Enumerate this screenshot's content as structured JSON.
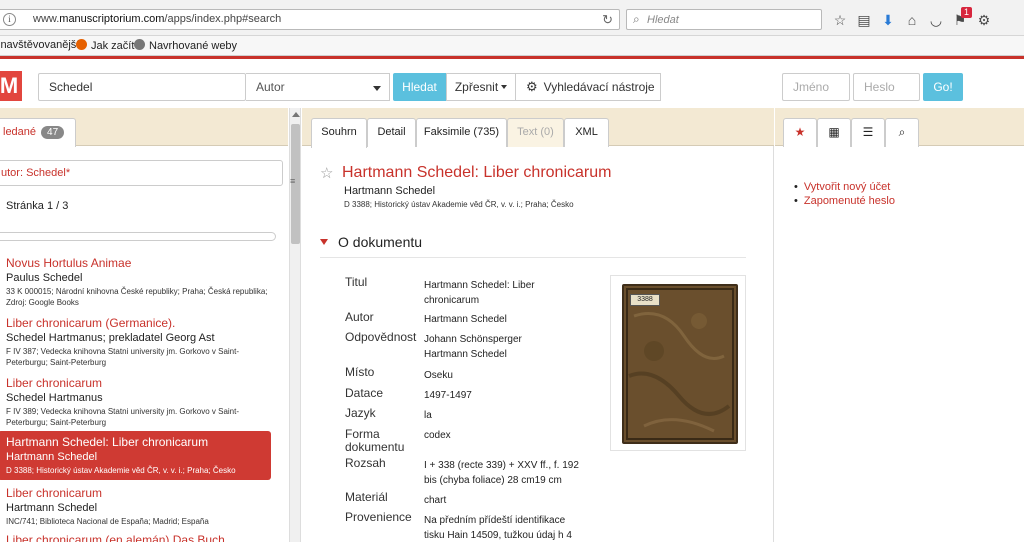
{
  "browser": {
    "url_prefix": "www.",
    "url_domain": "manuscriptorium.com",
    "url_path": "/apps/index.php#search",
    "search_placeholder": "Hledat",
    "notification_count": "1",
    "bookmarks": [
      {
        "label": "jnavštěvovanější",
        "icon_color": "#ffffff"
      },
      {
        "label": "Jak začít",
        "icon_color": "#e66000"
      },
      {
        "label": "Navrhované weby",
        "icon_color": "#777777"
      }
    ]
  },
  "header": {
    "logo": "M",
    "query_value": "Schedel",
    "field_select": "Autor",
    "search_button": "Hledat",
    "refine_button": "Zpřesnit",
    "tools_button": "Vyhledávací nástroje",
    "name_placeholder": "Jméno",
    "password_placeholder": "Heslo",
    "go_button": "Go!"
  },
  "left": {
    "tab_label": "ledané",
    "tab_count": "47",
    "filter": "utor: Schedel*",
    "page_info": "Stránka 1 / 3",
    "progress_fraction": 0.0,
    "results": [
      {
        "title": "Novus Hortulus Animae",
        "author": "Paulus Schedel",
        "meta": "33 K 000015; Národní knihovna České republiky; Praha; Česká republika; Zdroj: Google Books",
        "active": false
      },
      {
        "title": "Liber chronicarum (Germanice).",
        "author": "Schedel Hartmanus; prekladatel Georg Ast",
        "meta": "F IV 387; Vedecka knihovna Statni university jm. Gorkovo v Saint-Peterburgu; Saint-Peterburg",
        "active": false
      },
      {
        "title": "Liber chronicarum",
        "author": "Schedel Hartmanus",
        "meta": "F IV 389; Vedecka knihovna Statni university jm. Gorkovo v Saint-Peterburgu; Saint-Peterburg",
        "active": false
      },
      {
        "title": "Hartmann Schedel: Liber chronicarum",
        "author": "Hartmann Schedel",
        "meta": "D 3388; Historický ústav Akademie věd ČR, v. v. i.; Praha; Česko",
        "active": true
      },
      {
        "title": "Liber chronicarum",
        "author": "Hartmann Schedel",
        "meta": "INC/741; Biblioteca Nacional de España; Madrid; España",
        "active": false
      },
      {
        "title": "Liber chronicarum (en alemán) Das Buch",
        "author": "",
        "meta": "",
        "active": false
      }
    ]
  },
  "center": {
    "tabs": [
      {
        "label": "Souhrn",
        "state": "active"
      },
      {
        "label": "Detail",
        "state": "normal"
      },
      {
        "label": "Faksimile (735)",
        "state": "normal"
      },
      {
        "label": "Text (0)",
        "state": "disabled"
      },
      {
        "label": "XML",
        "state": "normal"
      }
    ],
    "doc_title": "Hartmann Schedel: Liber chronicarum",
    "doc_author": "Hartmann Schedel",
    "doc_meta": "D 3388; Historický ústav Akademie věd ČR, v. v. i.; Praha; Česko",
    "section_title": "O dokumentu",
    "thumb_label": "3388",
    "fields": [
      {
        "label": "Titul",
        "value": "Hartmann Schedel: Liber chronicarum"
      },
      {
        "label": "Autor",
        "value": "Hartmann Schedel"
      },
      {
        "label": "Odpovědnost",
        "value": "Johann Schönsperger Hartmann Schedel"
      },
      {
        "label": "Místo",
        "value": "Oseku"
      },
      {
        "label": "Datace",
        "value": "1497-1497"
      },
      {
        "label": "Jazyk",
        "value": "la"
      },
      {
        "label": "Forma dokumentu",
        "value": "codex"
      },
      {
        "label": "Rozsah",
        "value": "I + 338 (recte 339) + XXV ff., f. 192 bis (chyba foliace) 28 cm19 cm"
      },
      {
        "label": "Materiál",
        "value": "chart"
      },
      {
        "label": "Provenience",
        "value": "Na předním přídeští identifikace tisku Hain 14509, tužkou údaj h 4"
      }
    ]
  },
  "right": {
    "links": [
      "Vytvořit nový účet",
      "Zapomenuté heslo"
    ]
  },
  "colors": {
    "accent": "#c8322b",
    "button_blue": "#5bc0de",
    "tab_bar": "#f3e9d3"
  }
}
